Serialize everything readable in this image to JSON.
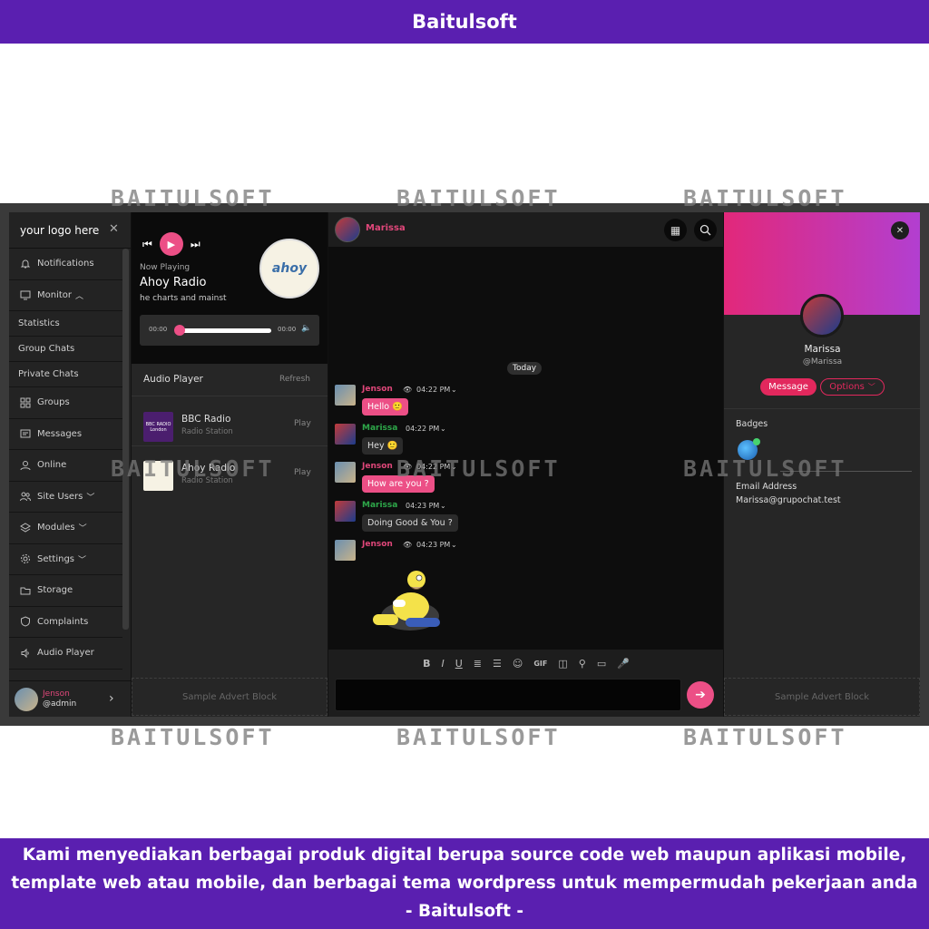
{
  "banner_top": "Baitulsoft",
  "watermark": "BAITULSOFT",
  "banner_bottom": {
    "line1": "Kami menyediakan berbagai produk digital berupa source code web maupun aplikasi mobile,",
    "line2": "template web atau mobile, dan berbagai tema wordpress untuk mempermudah pekerjaan anda",
    "line3": "- Baitulsoft -"
  },
  "sidebar": {
    "logo": "your logo here",
    "close_icon": "✕",
    "items": [
      {
        "label": "Notifications",
        "icon": "bell-icon"
      },
      {
        "label": "Monitor",
        "icon": "monitor-icon"
      },
      {
        "label": "Statistics"
      },
      {
        "label": "Group Chats"
      },
      {
        "label": "Private Chats"
      },
      {
        "label": "Groups",
        "icon": "grid-icon"
      },
      {
        "label": "Messages",
        "icon": "messages-icon"
      },
      {
        "label": "Online",
        "icon": "user-icon"
      },
      {
        "label": "Site Users",
        "icon": "users-icon"
      },
      {
        "label": "Modules",
        "icon": "layers-icon"
      },
      {
        "label": "Settings",
        "icon": "gear-icon"
      },
      {
        "label": "Storage",
        "icon": "folder-icon"
      },
      {
        "label": "Complaints",
        "icon": "shield-icon"
      },
      {
        "label": "Audio Player",
        "icon": "audio-icon"
      }
    ],
    "user": {
      "name": "Jenson",
      "handle": "@admin"
    }
  },
  "player": {
    "now_playing_label": "Now Playing",
    "station": "Ahoy Radio",
    "description": "he charts and mainst",
    "logo_text": "ahoy",
    "time_current": "00:00",
    "time_total": "00:00",
    "progress": 0
  },
  "audio_player": {
    "title": "Audio Player",
    "refresh": "Refresh",
    "stations": [
      {
        "name": "BBC Radio",
        "type": "Radio Station",
        "play": "Play",
        "thumb_text": "BBC RADIO London"
      },
      {
        "name": "Ahoy Radio",
        "type": "Radio Station",
        "play": "Play"
      }
    ]
  },
  "advert": "Sample Advert Block",
  "chat": {
    "contact": "Marissa",
    "today": "Today",
    "messages": [
      {
        "sender": "Jenson",
        "time": "04:22 PM",
        "text": "Hello 🙂",
        "mine": true
      },
      {
        "sender": "Marissa",
        "time": "04:22 PM",
        "text": "Hey 🙂",
        "mine": false
      },
      {
        "sender": "Jenson",
        "time": "04:22 PM",
        "text": "How are you ?",
        "mine": true
      },
      {
        "sender": "Marissa",
        "time": "04:23 PM",
        "text": "Doing Good & You ?",
        "mine": false
      },
      {
        "sender": "Jenson",
        "time": "04:23 PM",
        "text": "",
        "mine": true
      }
    ],
    "toolbar": [
      "B",
      "I",
      "U",
      "≣",
      "☰",
      "☺",
      "GIF",
      "◫",
      "⚲",
      "▭",
      "🎤"
    ],
    "colors": {
      "accent": "#ec4f86",
      "own_name": "#e0477a",
      "other_name": "#2ea84a"
    }
  },
  "profile": {
    "name": "Marissa",
    "handle": "@Marissa",
    "message_btn": "Message",
    "options_btn": "Options",
    "badges_label": "Badges",
    "email_label": "Email Address",
    "email": "Marissa@grupochat.test"
  }
}
